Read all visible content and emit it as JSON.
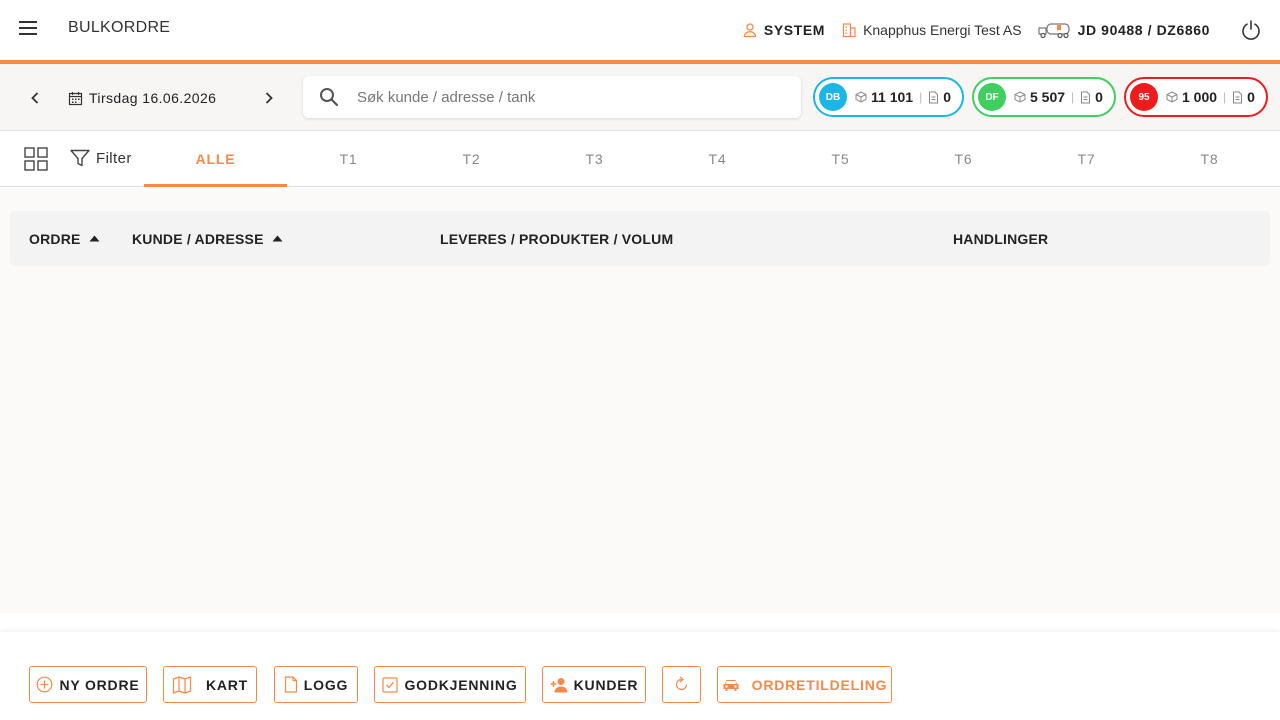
{
  "header": {
    "title": "BULKORDRE",
    "user": "SYSTEM",
    "company": "Knapphus Energi Test AS",
    "vehicle": "JD 90488 / DZ6860"
  },
  "toolbar": {
    "date": "Tirsdag 16.06.2026",
    "search_placeholder": "Søk kunde / adresse / tank",
    "products": [
      {
        "code": "DB",
        "volume": "11 101",
        "docs": "0",
        "color": "#1bb6e6"
      },
      {
        "code": "DF",
        "volume": "5 507",
        "docs": "0",
        "color": "#3ecf5e"
      },
      {
        "code": "95",
        "volume": "1 000",
        "docs": "0",
        "color": "#ee1c1c"
      }
    ]
  },
  "tabs": {
    "filter_label": "Filter",
    "items": [
      "ALLE",
      "T1",
      "T2",
      "T3",
      "T4",
      "T5",
      "T6",
      "T7",
      "T8"
    ],
    "active": "ALLE"
  },
  "table": {
    "columns": [
      "ORDRE",
      "KUNDE / ADRESSE",
      "LEVERES / PRODUKTER / VOLUM",
      "HANDLINGER"
    ]
  },
  "actions": {
    "new_order": "NY ORDRE",
    "map": "KART",
    "log": "LOGG",
    "approval": "GODKJENNING",
    "customers": "KUNDER",
    "assignment": "ORDRETILDELING"
  },
  "colors": {
    "accent": "#f5894a"
  }
}
